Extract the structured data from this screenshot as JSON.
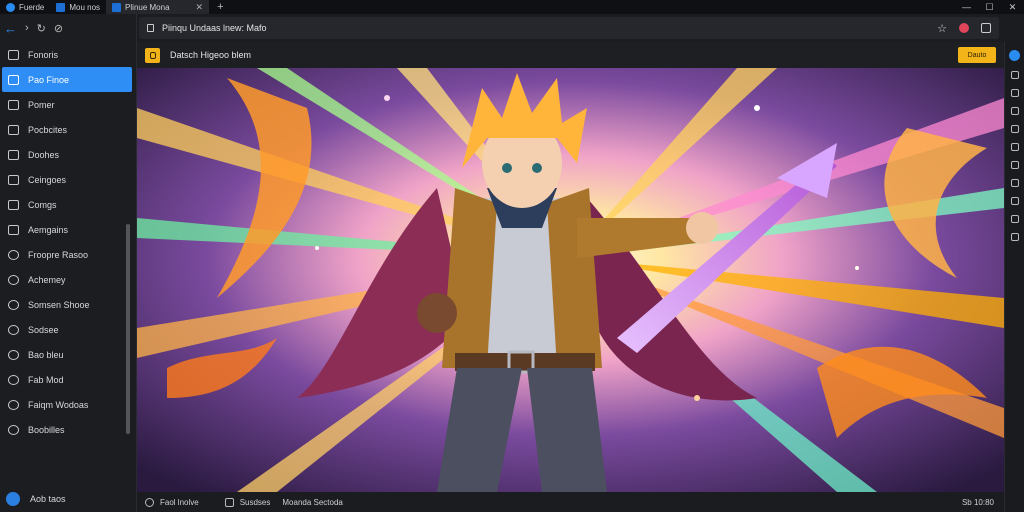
{
  "tabs": [
    {
      "label": "Fuerde",
      "active": false
    },
    {
      "label": "Mou nos",
      "active": false
    },
    {
      "label": "Plinue Mona",
      "active": true
    }
  ],
  "window_controls": [
    "—",
    "☐",
    "✕"
  ],
  "address": {
    "url": "Piinqu Undaas lnew: Mafo"
  },
  "page": {
    "site_title": "Datsch Higeoo blem",
    "cta_label": "Dauto"
  },
  "sidebar": {
    "items": [
      {
        "label": "Fonoris",
        "icon": "globe-icon"
      },
      {
        "label": "Pao Finoe",
        "icon": "folder-icon",
        "active": true
      },
      {
        "label": "Pomer",
        "icon": "home-icon"
      },
      {
        "label": "Pocbcites",
        "icon": "document-icon"
      },
      {
        "label": "Doohes",
        "icon": "calendar-icon"
      },
      {
        "label": "Ceingoes",
        "icon": "grid-icon"
      },
      {
        "label": "Comgs",
        "icon": "monitor-icon"
      },
      {
        "label": "Aemgains",
        "icon": "pen-icon"
      },
      {
        "label": "Froopre Rasoo",
        "icon": "clock-icon"
      },
      {
        "label": "Achemey",
        "icon": "chart-icon"
      },
      {
        "label": "Somsen Shooe",
        "icon": "bookmark-icon"
      },
      {
        "label": "Sodsee",
        "icon": "gear-icon"
      },
      {
        "label": "Bao bleu",
        "icon": "download-icon"
      },
      {
        "label": "Fab Mod",
        "icon": "tag-icon"
      },
      {
        "label": "Faiqm Wodoas",
        "icon": "note-icon"
      },
      {
        "label": "Boobilles",
        "icon": "list-icon"
      }
    ],
    "profile_label": "Aob taos"
  },
  "status": {
    "item1": "Faol lnolve",
    "item2": "Susdses",
    "item3": "Moanda Sectoda",
    "zoom": "Sb 10:80"
  },
  "colors": {
    "accent": "#2f8ef5",
    "brand": "#f2b418",
    "bg": "#1b1c20"
  }
}
